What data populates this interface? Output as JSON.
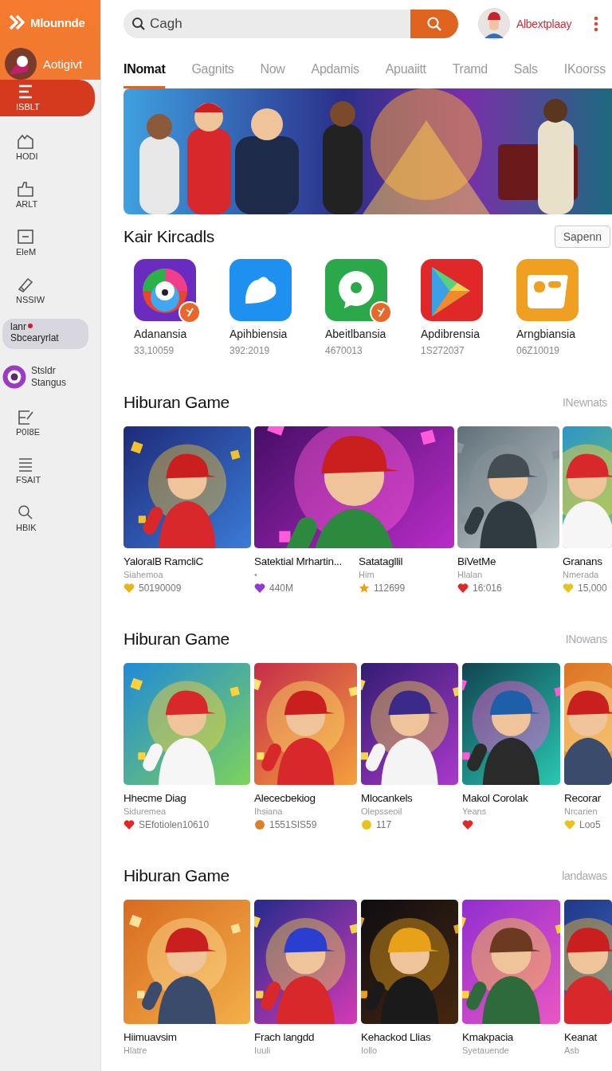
{
  "sidebar": {
    "logo": "Mlounnde",
    "profile": "Aotigivt",
    "items": [
      {
        "kind": "nav",
        "label": "ISBLT",
        "selected": true
      },
      {
        "kind": "nav",
        "label": "HODI",
        "selected": false
      },
      {
        "kind": "nav",
        "label": "ARLT",
        "selected": false
      },
      {
        "kind": "nav",
        "label": "EleM",
        "selected": false
      },
      {
        "kind": "nav",
        "label": "NSSIW",
        "selected": false
      },
      {
        "kind": "chip",
        "label": "lanr",
        "sublabel": "Sbcearyrlat",
        "selected": false
      },
      {
        "kind": "profile",
        "label": "Stsldr",
        "sublabel": "Stangus",
        "selected": false
      },
      {
        "kind": "nav",
        "label": "P0I8E",
        "selected": false
      },
      {
        "kind": "nav",
        "label": "FSAIT",
        "selected": false
      },
      {
        "kind": "nav",
        "label": "HBIK",
        "selected": false
      }
    ]
  },
  "header": {
    "search": {
      "placeholder": "Cagh"
    },
    "user": "Albextplaay"
  },
  "tabs": [
    {
      "label": "INomat",
      "selected": true
    },
    {
      "label": "Gagnits",
      "selected": false
    },
    {
      "label": "Now",
      "selected": false
    },
    {
      "label": "Apdamis",
      "selected": false
    },
    {
      "label": "Apuaiitt",
      "selected": false
    },
    {
      "label": "Tramd",
      "selected": false
    },
    {
      "label": "Sals",
      "selected": false
    },
    {
      "label": "IKoorss",
      "selected": false
    }
  ],
  "apps_section": {
    "title": "Kair Kircadls",
    "action": "Sapenn",
    "apps": [
      {
        "name": "Adanansia",
        "count": "33,10059",
        "badge": true
      },
      {
        "name": "Apihbiensia",
        "count": "392:2019",
        "badge": false
      },
      {
        "name": "Abeitlbansia",
        "count": "4670013",
        "badge": true
      },
      {
        "name": "Apdibrensia",
        "count": "1S272037",
        "badge": false
      },
      {
        "name": "Arngbiansia",
        "count": "06Z10019",
        "badge": false
      }
    ]
  },
  "game_sections": [
    {
      "title": "Hiburan Game",
      "action": "INewnats",
      "games": [
        {
          "kind": "tile",
          "name": "YaloralB RamcliC",
          "sub": "Siahemoa",
          "stat": {
            "kind": "heart",
            "color": "#e6b61c",
            "text": "50190009"
          }
        },
        {
          "kind": "wide",
          "name": "Satektial Mrhartin...",
          "sub": "•",
          "stat": {
            "kind": "heart",
            "color": "#8e3bd1",
            "text": "440M"
          }
        },
        {
          "kind": "caption",
          "name": "Satatagllil",
          "sub": "Him",
          "stat": {
            "kind": "star",
            "color": "#e8a21a",
            "text": "112699"
          }
        },
        {
          "kind": "tile",
          "name": "BiVetMe",
          "sub": "Hlalan",
          "stat": {
            "kind": "heart",
            "color": "#e02828",
            "text": "16:016"
          }
        },
        {
          "kind": "tile",
          "name": "Granans",
          "sub": "Nmerada",
          "stat": {
            "kind": "heart",
            "color": "#e8c21f",
            "text": "15,000"
          }
        }
      ]
    },
    {
      "title": "Hiburan Game",
      "action": "INowans",
      "games": [
        {
          "kind": "tile",
          "name": "Hhecme Diag",
          "sub": "Siduremea",
          "stat": {
            "kind": "heart",
            "color": "#e02828",
            "text": "SEfotiolen10610"
          }
        },
        {
          "kind": "tile",
          "name": "Alececbekiog",
          "sub": "Ihsiana",
          "stat": {
            "kind": "coin",
            "color": "#d9822b",
            "text": "1551SIS59"
          }
        },
        {
          "kind": "tile",
          "name": "Mlocankels",
          "sub": "Olepsseoil",
          "stat": {
            "kind": "coin",
            "color": "#e6c419",
            "text": "117"
          }
        },
        {
          "kind": "tile",
          "name": "Makol Corolak",
          "sub": "Yeans",
          "stat": {
            "kind": "heart",
            "color": "#e02828"
          }
        },
        {
          "kind": "tile",
          "name": "Recorar",
          "sub": "Nrcarien",
          "stat": {
            "kind": "heart",
            "color": "#e8c21f",
            "text": "Loo5"
          }
        }
      ]
    },
    {
      "title": "Hiburan Game",
      "action": "landawas",
      "games": [
        {
          "kind": "tile",
          "name": "Hiimuavsim",
          "sub": "Hlatre"
        },
        {
          "kind": "tile",
          "name": "Frach langdd",
          "sub": "Iuuli"
        },
        {
          "kind": "tile",
          "name": "Kehackod Llias",
          "sub": "Iollo"
        },
        {
          "kind": "tile",
          "name": "Kmakpacia",
          "sub": "Syetauende"
        },
        {
          "kind": "tile",
          "name": "Keanat",
          "sub": "Asb"
        }
      ]
    }
  ]
}
